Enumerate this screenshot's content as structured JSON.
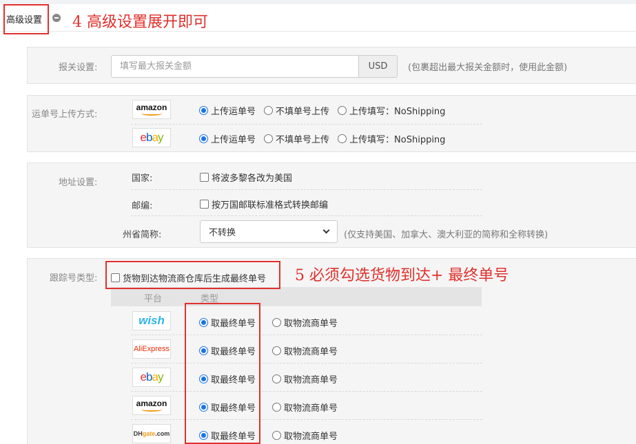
{
  "header": {
    "title": "高级设置",
    "annotation_4": "4 高级设置展开即可"
  },
  "customs": {
    "label": "报关设置:",
    "placeholder": "填写最大报关金额",
    "currency": "USD",
    "hint": "(包裹超出最大报关金额时，使用此金额)"
  },
  "upload": {
    "label": "运单号上传方式:",
    "platforms": [
      {
        "logo": "amazon",
        "options": [
          "上传运单号",
          "不填单号上传",
          "上传填写：NoShipping"
        ],
        "selected": 0
      },
      {
        "logo": "ebay",
        "options": [
          "上传运单号",
          "不填单号上传",
          "上传填写：NoShipping"
        ],
        "selected": 0
      }
    ]
  },
  "address": {
    "label": "地址设置:",
    "country_label": "国家:",
    "country_option": "将波多黎各改为美国",
    "zip_label": "邮编:",
    "zip_option": "按万国邮联标准格式转换邮编",
    "state_label": "州省简称:",
    "state_selected": "不转换",
    "state_hint": "(仅支持美国、加拿大、澳大利亚的简称和全称转换)"
  },
  "tracking": {
    "label": "跟踪号类型:",
    "checkbox_label": "货物到达物流商仓库后生成最终单号",
    "annotation_5": "5 必须勾选货物到达+ 最终单号",
    "col_platform": "平台",
    "col_type": "类型",
    "rows": [
      {
        "logo": "wish",
        "option_final": "取最终单号",
        "option_carrier": "取物流商单号"
      },
      {
        "logo": "aliexpress",
        "option_final": "取最终单号",
        "option_carrier": "取物流商单号"
      },
      {
        "logo": "ebay",
        "option_final": "取最终单号",
        "option_carrier": "取物流商单号"
      },
      {
        "logo": "amazon",
        "option_final": "取最终单号",
        "option_carrier": "取物流商单号"
      },
      {
        "logo": "dhgate",
        "option_final": "取最终单号",
        "option_carrier": "取物流商单号"
      }
    ]
  },
  "logos": {
    "amazon": "amazon",
    "ebay_e": "e",
    "ebay_b": "b",
    "ebay_a": "a",
    "ebay_y": "y",
    "wish": "wish",
    "aliexpress": "AliExpress",
    "dh_a": "DH",
    "dh_b": "gate",
    "dh_c": ".com"
  },
  "colors": {
    "annotation_red": "#e0302c",
    "radio_blue": "#1a73e8"
  }
}
